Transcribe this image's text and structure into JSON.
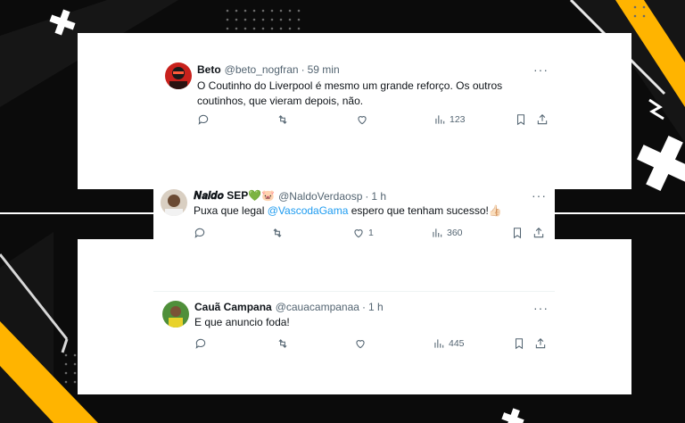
{
  "tweets": [
    {
      "name": "Beto",
      "handle": "@beto_nogfran",
      "separator": "·",
      "time": "59 min",
      "text": "O Coutinho do Liverpool é mesmo um grande reforço. Os outros coutinhos, que vieram depois, não.",
      "more": "···",
      "replies": "",
      "retweets": "",
      "likes": "",
      "views": "123"
    },
    {
      "name": "𝑵𝒂𝒍𝒅𝒐 SEP💚🐷",
      "handle": "@NaldoVerdaosp",
      "separator": "·",
      "time": "1 h",
      "text_before": "Puxa que legal ",
      "mention": "@VascodaGama",
      "text_after": "  espero que tenham sucesso!👍🏻",
      "more": "···",
      "replies": "",
      "retweets": "",
      "likes": "1",
      "views": "360"
    },
    {
      "name": "Cauã Campana",
      "handle": "@cauacampanaa",
      "separator": "·",
      "time": "1 h",
      "text": "E que anuncio foda!",
      "more": "···",
      "replies": "",
      "retweets": "",
      "likes": "",
      "views": "445"
    }
  ],
  "colors": {
    "background": "#0b0b0b",
    "accent_yellow": "#ffb400",
    "text_primary": "#0f1419",
    "text_secondary": "#536471",
    "link": "#1d9bf0"
  },
  "icons": [
    "reply-icon",
    "retweet-icon",
    "like-icon",
    "views-icon",
    "bookmark-icon",
    "share-icon",
    "more-icon"
  ]
}
